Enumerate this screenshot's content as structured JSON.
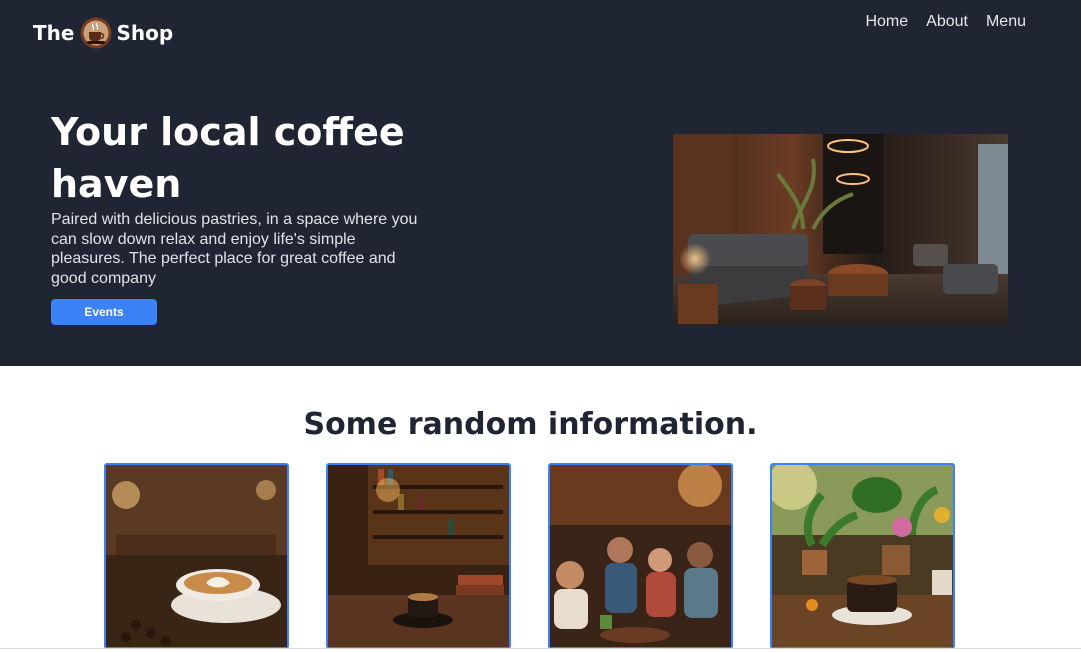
{
  "brand": {
    "name_left": "The",
    "name_right": "Shop",
    "logo_icon": "coffee-cup-badge-icon"
  },
  "nav": {
    "items": [
      {
        "label": "Home"
      },
      {
        "label": "About"
      },
      {
        "label": "Menu"
      }
    ]
  },
  "hero": {
    "title": "Your local coffee haven",
    "text": "Paired with delicious pastries, in a space where you can slow down relax and enjoy life's simple pleasures. The perfect place for great coffee and good company",
    "button_label": "Events",
    "image": "coffee-lounge-interior-image"
  },
  "info": {
    "title": "Some random information.",
    "cards": [
      {
        "image": "latte-art-cafe-image"
      },
      {
        "image": "bookshelf-coffee-image"
      },
      {
        "image": "friends-in-cafe-image"
      },
      {
        "image": "plants-and-coffee-image"
      }
    ]
  },
  "colors": {
    "hero_bg": "#1f2533",
    "accent": "#3b82f6",
    "heading_dark": "#1f2533"
  }
}
